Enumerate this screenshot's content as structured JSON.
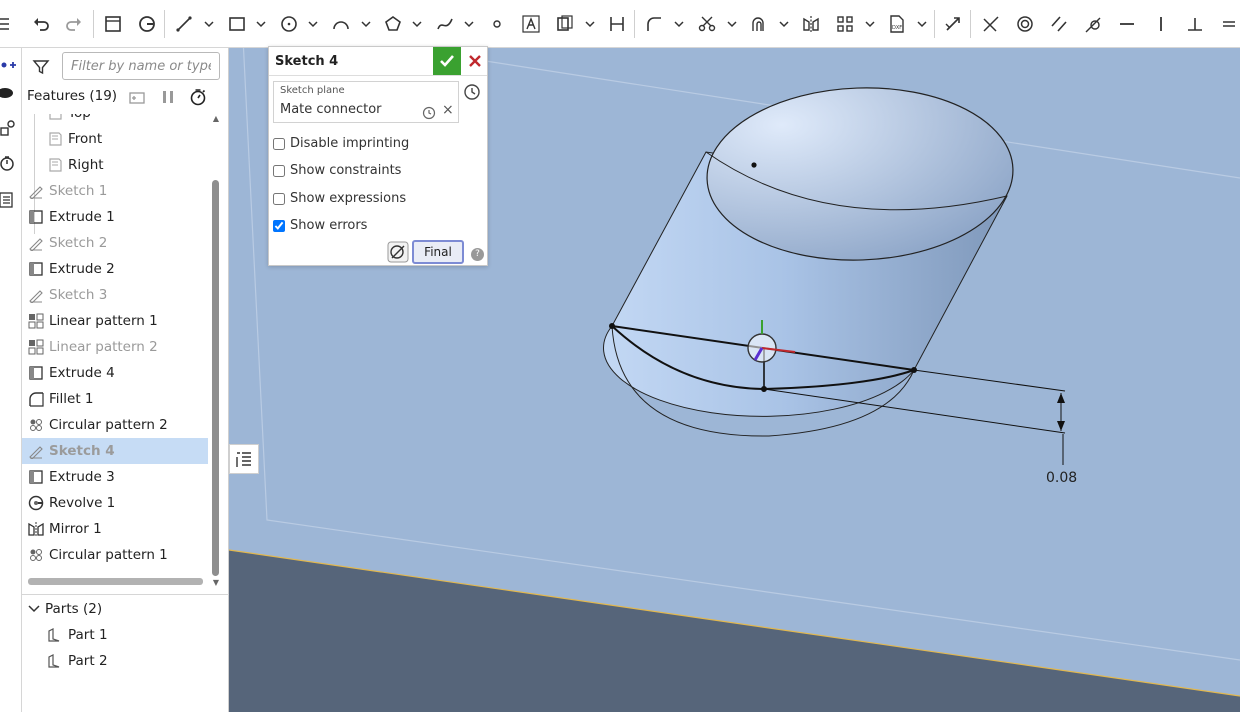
{
  "filter": {
    "placeholder": "Filter by name or type"
  },
  "features_header": "Features (19)",
  "features": [
    {
      "label": "Top",
      "icon": "plane-icon",
      "style": "plane"
    },
    {
      "label": "Front",
      "icon": "plane-icon",
      "style": "plane"
    },
    {
      "label": "Right",
      "icon": "plane-icon",
      "style": "plane"
    },
    {
      "label": "Sketch 1",
      "icon": "sketch-icon",
      "style": "dim"
    },
    {
      "label": "Extrude 1",
      "icon": "extrude-icon",
      "style": ""
    },
    {
      "label": "Sketch 2",
      "icon": "sketch-icon",
      "style": "dim"
    },
    {
      "label": "Extrude 2",
      "icon": "extrude-icon",
      "style": ""
    },
    {
      "label": "Sketch 3",
      "icon": "sketch-icon",
      "style": "dim"
    },
    {
      "label": "Linear pattern 1",
      "icon": "linear-pattern-icon",
      "style": ""
    },
    {
      "label": "Linear pattern 2",
      "icon": "linear-pattern-icon",
      "style": "dim"
    },
    {
      "label": "Extrude 4",
      "icon": "extrude-icon",
      "style": ""
    },
    {
      "label": "Fillet 1",
      "icon": "fillet-icon",
      "style": ""
    },
    {
      "label": "Circular pattern 2",
      "icon": "circular-pattern-icon",
      "style": ""
    },
    {
      "label": "Sketch 4",
      "icon": "sketch-icon",
      "style": "sel"
    },
    {
      "label": "Extrude 3",
      "icon": "extrude-icon",
      "style": ""
    },
    {
      "label": "Revolve 1",
      "icon": "revolve-icon",
      "style": ""
    },
    {
      "label": "Mirror 1",
      "icon": "mirror-icon",
      "style": ""
    },
    {
      "label": "Circular pattern 1",
      "icon": "circular-pattern-icon",
      "style": ""
    }
  ],
  "parts": {
    "header": "Parts (2)",
    "items": [
      "Part 1",
      "Part 2"
    ]
  },
  "dialog": {
    "title": "Sketch 4",
    "plane_label": "Sketch plane",
    "plane_value": "Mate connector",
    "options": [
      {
        "label": "Disable imprinting",
        "checked": false
      },
      {
        "label": "Show constraints",
        "checked": false
      },
      {
        "label": "Show expressions",
        "checked": false
      },
      {
        "label": "Show errors",
        "checked": true
      }
    ],
    "final_label": "Final",
    "help": "?"
  },
  "viewport": {
    "dimension": "0.08"
  },
  "colors": {
    "accept_green": "#3aa130",
    "cancel_red": "#c0282d",
    "selection_bg": "#c6dcf5",
    "viewport_bg": "#9db6d6",
    "ground": "#56657a"
  }
}
